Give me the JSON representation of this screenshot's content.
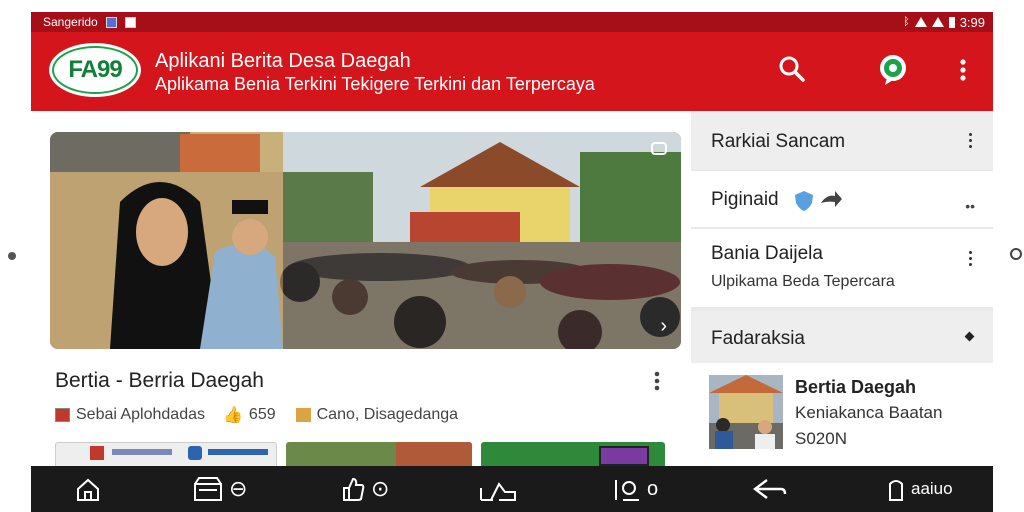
{
  "status_bar": {
    "carrier": "Sangerido",
    "time": "3:99"
  },
  "app_bar": {
    "logo_text": "FA99",
    "title": "Aplikani Berita Desa Daegah",
    "subtitle": "Aplikama Benia Terkini Tekigere Terkini dan Terpercaya",
    "icons": [
      "search-icon",
      "chat-icon",
      "overflow-menu-icon"
    ]
  },
  "featured": {
    "headline": "Bertia - Berria Daegah",
    "meta": {
      "source": "Sebai Aplohdadas",
      "likes": "659",
      "location": "Cano, Disagedanga"
    }
  },
  "sidebar": {
    "sections": [
      {
        "title": "Rarkiai Sancam"
      },
      {
        "title": "Piginaid",
        "badge_icon": "shield-icon"
      },
      {
        "title": "Bania Daijela",
        "subtitle": "Ulpikama Beda Tepercara"
      },
      {
        "title": "Fadaraksia"
      }
    ],
    "news_item": {
      "title": "Bertia Daegah",
      "line1": "Keniakanca Baatan",
      "line2": "S020N"
    }
  },
  "bottom_nav": {
    "items": [
      {
        "icon": "home-icon"
      },
      {
        "icon": "store-icon",
        "label": "⊖"
      },
      {
        "icon": "like-icon",
        "label": "⊙"
      },
      {
        "icon": "share-icon",
        "label": ""
      },
      {
        "icon": "notes-icon",
        "label": "o"
      },
      {
        "icon": "back-icon",
        "label": ""
      },
      {
        "icon": "account-icon",
        "label": "aaiuo"
      }
    ]
  },
  "colors": {
    "brand_red": "#d4161c",
    "status_red": "#a60e18",
    "logo_green": "#1aa34a",
    "nav_dark": "#1a1a1a"
  }
}
